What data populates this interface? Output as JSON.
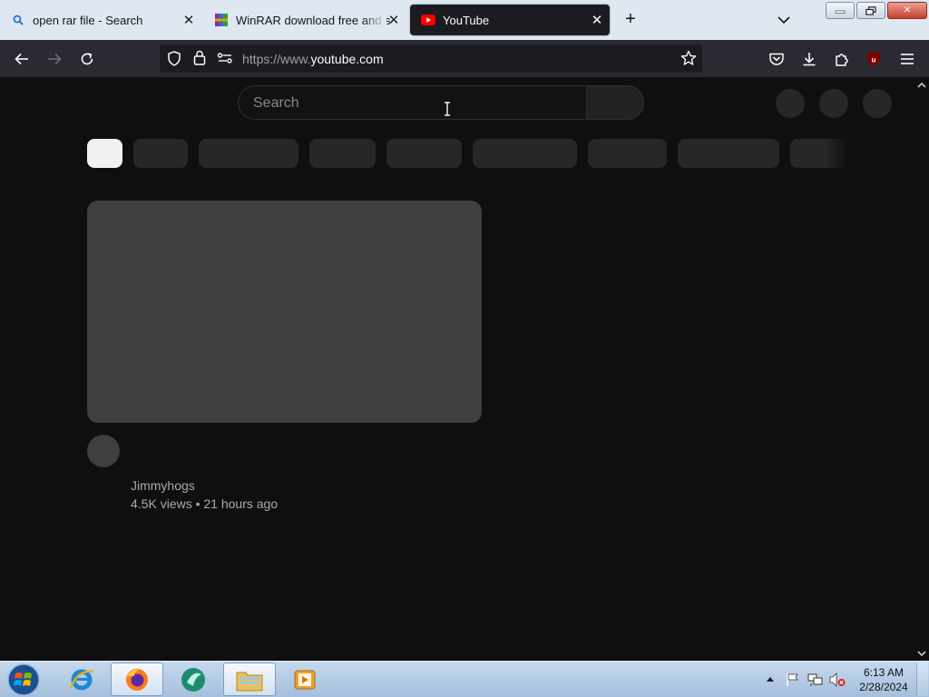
{
  "browser": {
    "tabs": [
      {
        "title": "open rar file - Search",
        "icon": "search-icon",
        "active": false
      },
      {
        "title": "WinRAR download free and support",
        "icon": "winrar-icon",
        "active": false
      },
      {
        "title": "YouTube",
        "icon": "youtube-icon",
        "active": true
      }
    ],
    "address": {
      "prefix": "https://www.",
      "domain": "youtube.com"
    },
    "extension_badge": "2"
  },
  "youtube": {
    "search_placeholder": "Search",
    "video": {
      "channel": "Jimmyhogs",
      "meta": "4.5K views • 21 hours ago"
    }
  },
  "taskbar": {
    "clock_time": "6:13 AM",
    "clock_date": "2/28/2024"
  },
  "colors": {
    "tab_strip": "#dfe7f1",
    "toolbar": "#2b2a33",
    "page_bg": "#0f0f0f",
    "placeholder_block": "#272727",
    "youtube_red": "#ff0000"
  }
}
